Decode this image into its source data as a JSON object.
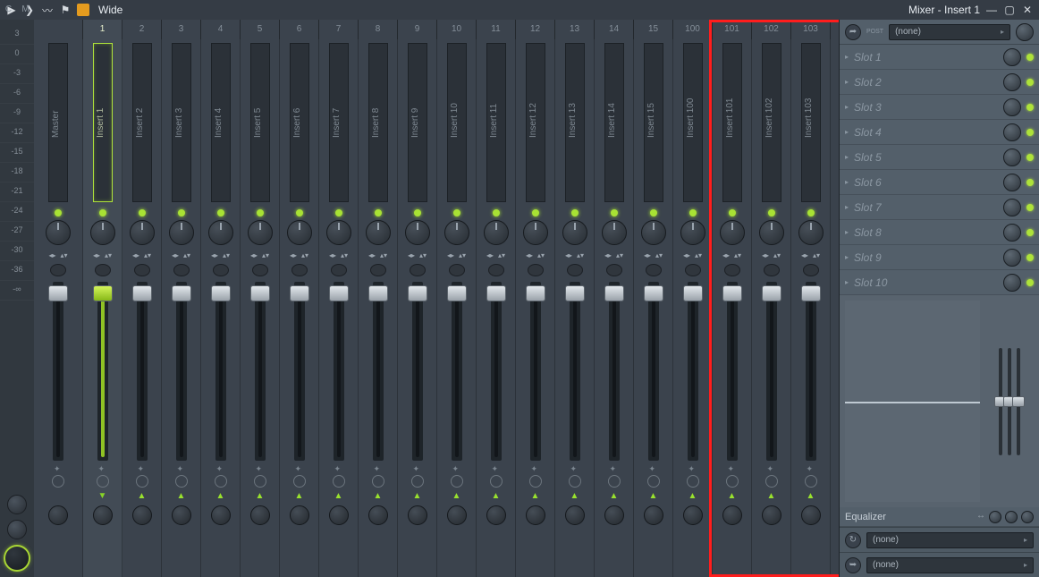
{
  "title": {
    "preset": "Wide",
    "window": "Mixer - Insert 1"
  },
  "ruler": [
    "3",
    "0",
    "-3",
    "-6",
    "-9",
    "-12",
    "-15",
    "-18",
    "-21",
    "-24",
    "-27",
    "-30",
    "-36",
    "-∞"
  ],
  "corner": {
    "c": "C",
    "m": "M"
  },
  "tracks": [
    {
      "num": "",
      "label": "Master",
      "master": true,
      "selected": false
    },
    {
      "num": "1",
      "label": "Insert 1",
      "master": false,
      "selected": true
    },
    {
      "num": "2",
      "label": "Insert 2",
      "master": false,
      "selected": false
    },
    {
      "num": "3",
      "label": "Insert 3",
      "master": false,
      "selected": false
    },
    {
      "num": "4",
      "label": "Insert 4",
      "master": false,
      "selected": false
    },
    {
      "num": "5",
      "label": "Insert 5",
      "master": false,
      "selected": false
    },
    {
      "num": "6",
      "label": "Insert 6",
      "master": false,
      "selected": false
    },
    {
      "num": "7",
      "label": "Insert 7",
      "master": false,
      "selected": false
    },
    {
      "num": "8",
      "label": "Insert 8",
      "master": false,
      "selected": false
    },
    {
      "num": "9",
      "label": "Insert 9",
      "master": false,
      "selected": false
    },
    {
      "num": "10",
      "label": "Insert 10",
      "master": false,
      "selected": false
    },
    {
      "num": "11",
      "label": "Insert 11",
      "master": false,
      "selected": false
    },
    {
      "num": "12",
      "label": "Insert 12",
      "master": false,
      "selected": false
    },
    {
      "num": "13",
      "label": "Insert 13",
      "master": false,
      "selected": false
    },
    {
      "num": "14",
      "label": "Insert 14",
      "master": false,
      "selected": false
    },
    {
      "num": "15",
      "label": "Insert 15",
      "master": false,
      "selected": false
    },
    {
      "num": "100",
      "label": "Insert 100",
      "master": false,
      "selected": false
    },
    {
      "num": "101",
      "label": "Insert 101",
      "master": false,
      "selected": false
    },
    {
      "num": "102",
      "label": "Insert 102",
      "master": false,
      "selected": false
    },
    {
      "num": "103",
      "label": "Insert 103",
      "master": false,
      "selected": false
    }
  ],
  "sidebar": {
    "input": "(none)",
    "post_label": "POST",
    "slots": [
      "Slot 1",
      "Slot 2",
      "Slot 3",
      "Slot 4",
      "Slot 5",
      "Slot 6",
      "Slot 7",
      "Slot 8",
      "Slot 9",
      "Slot 10"
    ],
    "eq_label": "Equalizer",
    "out1": "(none)",
    "out2": "(none)"
  }
}
